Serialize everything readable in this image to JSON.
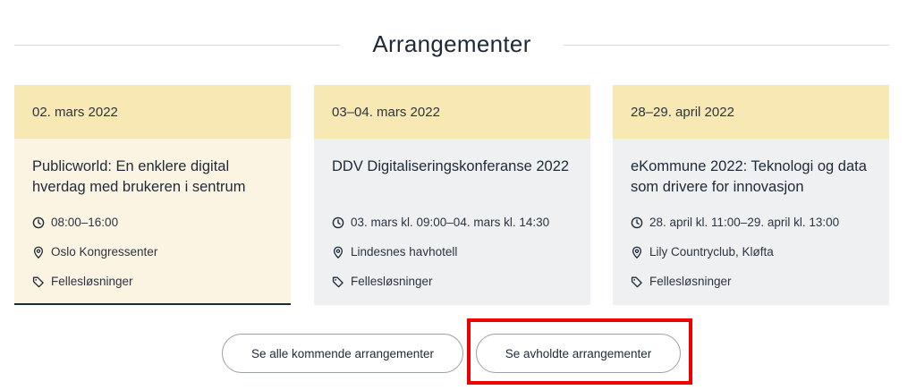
{
  "section": {
    "title": "Arrangementer"
  },
  "events": [
    {
      "date": "02. mars 2022",
      "title": "Publicworld: En enklere digital hverdag med brukeren i sentrum",
      "time": "08:00–16:00",
      "location": "Oslo Kongressenter",
      "tag": "Fellesløsninger"
    },
    {
      "date": "03–04. mars 2022",
      "title": "DDV Digitaliseringskonferanse 2022",
      "time": "03. mars kl. 09:00–04. mars kl. 14:30",
      "location": "Lindesnes havhotell",
      "tag": "Fellesløsninger"
    },
    {
      "date": "28–29. april 2022",
      "title": "eKommune 2022: Teknologi og data som drivere for innovasjon",
      "time": "28. april kl. 11:00–29. april kl. 13:00",
      "location": "Lily Countryclub, Kløfta",
      "tag": "Fellesløsninger"
    }
  ],
  "buttons": {
    "all_upcoming": "Se alle kommende arrangementer",
    "past": "Se avholdte arrangementer"
  },
  "icons": {
    "time": "clock-icon",
    "location": "map-pin-icon",
    "tag": "tag-icon"
  },
  "colors": {
    "date_band": "#f8e8b3",
    "card_active_bg": "#fbf4e3",
    "card_bg": "#eef0f2",
    "text": "#1f2a37",
    "highlight": "#ee0000"
  }
}
